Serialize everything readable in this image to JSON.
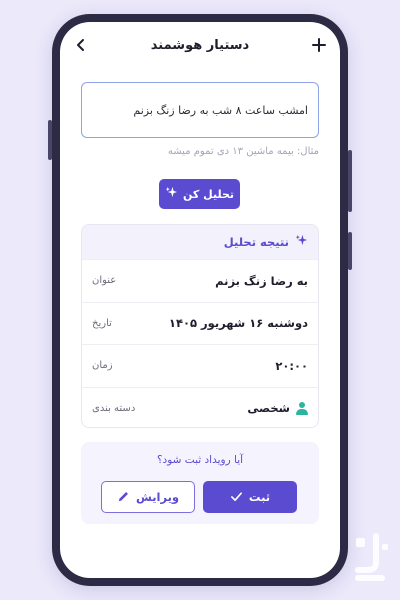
{
  "header": {
    "title": "دستیار هوشمند",
    "back_icon": "‹",
    "add_icon": "+"
  },
  "input": {
    "value": "امشب ساعت ۸ شب به رضا زنگ بزنم"
  },
  "hint": "مثال: بیمه ماشین ۱۳ دی تموم میشه",
  "analyze_button": {
    "label": "تحلیل کن",
    "icon": "sparkles-icon"
  },
  "result": {
    "title": "نتیجه تحلیل",
    "rows": [
      {
        "value": "به رضا زنگ بزنم",
        "label": "عنوان"
      },
      {
        "value": "دوشنبه ۱۶ شهریور ۱۴۰۵",
        "label": "تاریخ"
      },
      {
        "value": "۲۰:۰۰",
        "label": "زمان"
      },
      {
        "value": "شخصی",
        "label": "دسته بندی"
      }
    ]
  },
  "confirm": {
    "question": "آیا رویداد ثبت شود؟",
    "save_label": "ثبت",
    "edit_label": "ویرایش"
  },
  "colors": {
    "accent": "#5b4bd1",
    "background": "#ece9fb",
    "category": "#2bb5a0"
  }
}
